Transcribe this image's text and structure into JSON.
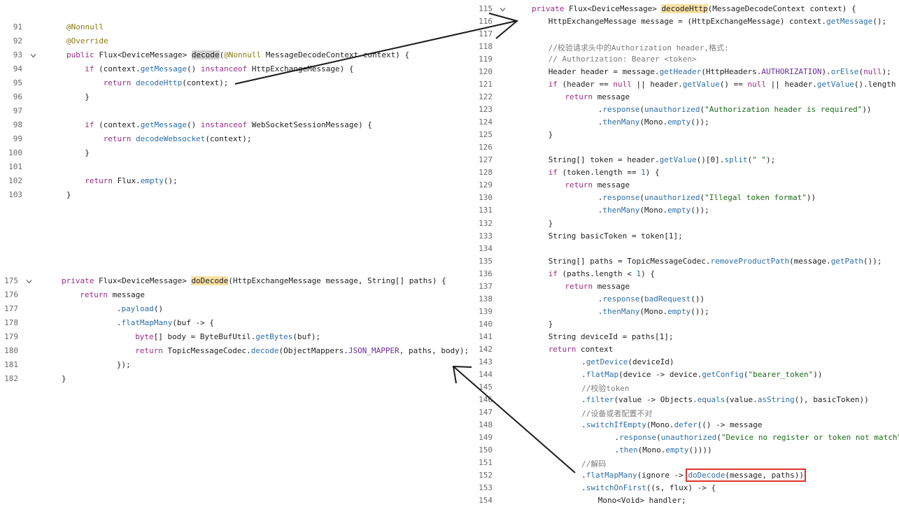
{
  "panel_decode": {
    "lines": [
      {
        "n": "91",
        "fold": false,
        "indent": 0,
        "tokens": [
          {
            "t": "@Nonnull",
            "c": "an"
          }
        ]
      },
      {
        "n": "92",
        "fold": false,
        "indent": 0,
        "tokens": [
          {
            "t": "@Override",
            "c": "an"
          }
        ]
      },
      {
        "n": "93",
        "fold": true,
        "indent": 0,
        "tokens": [
          {
            "t": "public ",
            "c": "kw"
          },
          {
            "t": "Flux<DeviceMessage> "
          },
          {
            "t": "decode",
            "c": "hl-grey"
          },
          {
            "t": "("
          },
          {
            "t": "@Nonnull",
            "c": "an"
          },
          {
            "t": " MessageDecodeContext context) {"
          }
        ]
      },
      {
        "n": "94",
        "fold": false,
        "indent": 1,
        "tokens": [
          {
            "t": "if",
            "c": "kw"
          },
          {
            "t": " (context."
          },
          {
            "t": "getMessage",
            "c": "mt"
          },
          {
            "t": "() "
          },
          {
            "t": "instanceof",
            "c": "kw"
          },
          {
            "t": " HttpExchangeMessage) {"
          }
        ]
      },
      {
        "n": "95",
        "fold": false,
        "indent": 2,
        "tokens": [
          {
            "t": "return",
            "c": "kw"
          },
          {
            "t": " "
          },
          {
            "t": "decodeHttp",
            "c": "mt"
          },
          {
            "t": "(context);"
          }
        ]
      },
      {
        "n": "96",
        "fold": false,
        "indent": 1,
        "tokens": [
          {
            "t": "}"
          }
        ]
      },
      {
        "n": "97",
        "fold": false,
        "indent": 0,
        "tokens": []
      },
      {
        "n": "98",
        "fold": false,
        "indent": 1,
        "tokens": [
          {
            "t": "if",
            "c": "kw"
          },
          {
            "t": " (context."
          },
          {
            "t": "getMessage",
            "c": "mt"
          },
          {
            "t": "() "
          },
          {
            "t": "instanceof",
            "c": "kw"
          },
          {
            "t": " WebSocketSessionMessage) {"
          }
        ]
      },
      {
        "n": "99",
        "fold": false,
        "indent": 2,
        "tokens": [
          {
            "t": "return",
            "c": "kw"
          },
          {
            "t": " "
          },
          {
            "t": "decodeWebsocket",
            "c": "mt"
          },
          {
            "t": "(context);"
          }
        ]
      },
      {
        "n": "100",
        "fold": false,
        "indent": 1,
        "tokens": [
          {
            "t": "}"
          }
        ]
      },
      {
        "n": "101",
        "fold": false,
        "indent": 0,
        "tokens": []
      },
      {
        "n": "102",
        "fold": false,
        "indent": 1,
        "tokens": [
          {
            "t": "return",
            "c": "kw"
          },
          {
            "t": " Flux."
          },
          {
            "t": "empty",
            "c": "mt"
          },
          {
            "t": "();"
          }
        ]
      },
      {
        "n": "103",
        "fold": false,
        "indent": 0,
        "tokens": [
          {
            "t": "}"
          }
        ]
      }
    ]
  },
  "panel_dodecode": {
    "lines": [
      {
        "n": "175",
        "fold": true,
        "indent": 0,
        "tokens": [
          {
            "t": "private ",
            "c": "kw"
          },
          {
            "t": "Flux<DeviceMessage> "
          },
          {
            "t": "doDecode",
            "c": "hl-yellow"
          },
          {
            "t": "(HttpExchangeMessage message, String[] paths) {"
          }
        ]
      },
      {
        "n": "176",
        "fold": false,
        "indent": 1,
        "tokens": [
          {
            "t": "return",
            "c": "kw"
          },
          {
            "t": " message"
          }
        ]
      },
      {
        "n": "177",
        "fold": false,
        "indent": 3,
        "tokens": [
          {
            "t": "."
          },
          {
            "t": "payload",
            "c": "mt"
          },
          {
            "t": "()"
          }
        ]
      },
      {
        "n": "178",
        "fold": false,
        "indent": 3,
        "tokens": [
          {
            "t": "."
          },
          {
            "t": "flatMapMany",
            "c": "mt"
          },
          {
            "t": "(buf -> {"
          }
        ]
      },
      {
        "n": "179",
        "fold": false,
        "indent": 4,
        "tokens": [
          {
            "t": "byte",
            "c": "kw"
          },
          {
            "t": "[] body = ByteBufUtil."
          },
          {
            "t": "getBytes",
            "c": "mt"
          },
          {
            "t": "(buf);"
          }
        ]
      },
      {
        "n": "180",
        "fold": false,
        "indent": 4,
        "tokens": [
          {
            "t": "return",
            "c": "kw"
          },
          {
            "t": " TopicMessageCodec."
          },
          {
            "t": "decode",
            "c": "mt"
          },
          {
            "t": "(ObjectMappers."
          },
          {
            "t": "JSON_MAPPER",
            "c": "cn"
          },
          {
            "t": ", paths, body);"
          }
        ]
      },
      {
        "n": "181",
        "fold": false,
        "indent": 3,
        "tokens": [
          {
            "t": "});"
          }
        ]
      },
      {
        "n": "182",
        "fold": false,
        "indent": 0,
        "tokens": [
          {
            "t": "}"
          }
        ]
      }
    ]
  },
  "panel_decodehttp": {
    "lines": [
      {
        "n": "115",
        "fold": true,
        "indent": 0,
        "tokens": [
          {
            "t": "private ",
            "c": "kw"
          },
          {
            "t": "Flux<DeviceMessage> "
          },
          {
            "t": "decodeHttp",
            "c": "hl-yellow"
          },
          {
            "t": "(MessageDecodeContext context) {"
          }
        ]
      },
      {
        "n": "116",
        "fold": false,
        "indent": 1,
        "tokens": [
          {
            "t": "HttpExchangeMessage message = (HttpExchangeMessage) context."
          },
          {
            "t": "getMessage",
            "c": "mt"
          },
          {
            "t": "();"
          }
        ]
      },
      {
        "n": "117",
        "fold": false,
        "indent": 0,
        "tokens": []
      },
      {
        "n": "118",
        "fold": false,
        "indent": 1,
        "tokens": [
          {
            "t": "//校验请求头中的Authorization header,格式:",
            "c": "cm"
          }
        ]
      },
      {
        "n": "119",
        "fold": false,
        "indent": 1,
        "tokens": [
          {
            "t": "// Authorization: Bearer <token>",
            "c": "cm"
          }
        ]
      },
      {
        "n": "120",
        "fold": false,
        "indent": 1,
        "tokens": [
          {
            "t": "Header header = message."
          },
          {
            "t": "getHeader",
            "c": "mt"
          },
          {
            "t": "(HttpHeaders."
          },
          {
            "t": "AUTHORIZATION",
            "c": "cn"
          },
          {
            "t": ")."
          },
          {
            "t": "orElse",
            "c": "mt"
          },
          {
            "t": "("
          },
          {
            "t": "null",
            "c": "kw"
          },
          {
            "t": ");"
          }
        ]
      },
      {
        "n": "121",
        "fold": false,
        "indent": 1,
        "tokens": [
          {
            "t": "if",
            "c": "kw"
          },
          {
            "t": " (header == "
          },
          {
            "t": "null",
            "c": "kw"
          },
          {
            "t": " || header."
          },
          {
            "t": "getValue",
            "c": "mt"
          },
          {
            "t": "() == "
          },
          {
            "t": "null",
            "c": "kw"
          },
          {
            "t": " || header."
          },
          {
            "t": "getValue",
            "c": "mt"
          },
          {
            "t": "().length == "
          },
          {
            "t": "0",
            "c": "mt"
          },
          {
            "t": ") {"
          }
        ]
      },
      {
        "n": "122",
        "fold": false,
        "indent": 2,
        "tokens": [
          {
            "t": "return",
            "c": "kw"
          },
          {
            "t": " message"
          }
        ]
      },
      {
        "n": "123",
        "fold": false,
        "indent": 4,
        "tokens": [
          {
            "t": "."
          },
          {
            "t": "response",
            "c": "mt"
          },
          {
            "t": "("
          },
          {
            "t": "unauthorized",
            "c": "mt"
          },
          {
            "t": "("
          },
          {
            "t": "\"Authorization header is required\"",
            "c": "st"
          },
          {
            "t": "))"
          }
        ]
      },
      {
        "n": "124",
        "fold": false,
        "indent": 4,
        "tokens": [
          {
            "t": "."
          },
          {
            "t": "thenMany",
            "c": "mt"
          },
          {
            "t": "(Mono."
          },
          {
            "t": "empty",
            "c": "mt"
          },
          {
            "t": "());"
          }
        ]
      },
      {
        "n": "125",
        "fold": false,
        "indent": 1,
        "tokens": [
          {
            "t": "}"
          }
        ]
      },
      {
        "n": "126",
        "fold": false,
        "indent": 0,
        "tokens": []
      },
      {
        "n": "127",
        "fold": false,
        "indent": 1,
        "tokens": [
          {
            "t": "String[] token = header."
          },
          {
            "t": "getValue",
            "c": "mt"
          },
          {
            "t": "()[0]."
          },
          {
            "t": "split",
            "c": "mt"
          },
          {
            "t": "("
          },
          {
            "t": "\" \"",
            "c": "st"
          },
          {
            "t": ");"
          }
        ]
      },
      {
        "n": "128",
        "fold": false,
        "indent": 1,
        "tokens": [
          {
            "t": "if",
            "c": "kw"
          },
          {
            "t": " (token.length == "
          },
          {
            "t": "1",
            "c": "mt"
          },
          {
            "t": ") {"
          }
        ]
      },
      {
        "n": "129",
        "fold": false,
        "indent": 2,
        "tokens": [
          {
            "t": "return",
            "c": "kw"
          },
          {
            "t": " message"
          }
        ]
      },
      {
        "n": "130",
        "fold": false,
        "indent": 4,
        "tokens": [
          {
            "t": "."
          },
          {
            "t": "response",
            "c": "mt"
          },
          {
            "t": "("
          },
          {
            "t": "unauthorized",
            "c": "mt"
          },
          {
            "t": "("
          },
          {
            "t": "\"Illegal token format\"",
            "c": "st"
          },
          {
            "t": "))"
          }
        ]
      },
      {
        "n": "131",
        "fold": false,
        "indent": 4,
        "tokens": [
          {
            "t": "."
          },
          {
            "t": "thenMany",
            "c": "mt"
          },
          {
            "t": "(Mono."
          },
          {
            "t": "empty",
            "c": "mt"
          },
          {
            "t": "());"
          }
        ]
      },
      {
        "n": "132",
        "fold": false,
        "indent": 1,
        "tokens": [
          {
            "t": "}"
          }
        ]
      },
      {
        "n": "133",
        "fold": false,
        "indent": 1,
        "tokens": [
          {
            "t": "String basicToken = token[1];"
          }
        ]
      },
      {
        "n": "134",
        "fold": false,
        "indent": 0,
        "tokens": []
      },
      {
        "n": "135",
        "fold": false,
        "indent": 1,
        "tokens": [
          {
            "t": "String[] paths = TopicMessageCodec."
          },
          {
            "t": "removeProductPath",
            "c": "mt"
          },
          {
            "t": "(message."
          },
          {
            "t": "getPath",
            "c": "mt"
          },
          {
            "t": "());"
          }
        ]
      },
      {
        "n": "136",
        "fold": false,
        "indent": 1,
        "tokens": [
          {
            "t": "if",
            "c": "kw"
          },
          {
            "t": " (paths.length < "
          },
          {
            "t": "1",
            "c": "mt"
          },
          {
            "t": ") {"
          }
        ]
      },
      {
        "n": "137",
        "fold": false,
        "indent": 2,
        "tokens": [
          {
            "t": "return",
            "c": "kw"
          },
          {
            "t": " message"
          }
        ]
      },
      {
        "n": "138",
        "fold": false,
        "indent": 4,
        "tokens": [
          {
            "t": "."
          },
          {
            "t": "response",
            "c": "mt"
          },
          {
            "t": "("
          },
          {
            "t": "badRequest",
            "c": "mt"
          },
          {
            "t": "())"
          }
        ]
      },
      {
        "n": "139",
        "fold": false,
        "indent": 4,
        "tokens": [
          {
            "t": "."
          },
          {
            "t": "thenMany",
            "c": "mt"
          },
          {
            "t": "(Mono."
          },
          {
            "t": "empty",
            "c": "mt"
          },
          {
            "t": "());"
          }
        ]
      },
      {
        "n": "140",
        "fold": false,
        "indent": 1,
        "tokens": [
          {
            "t": "}"
          }
        ]
      },
      {
        "n": "141",
        "fold": false,
        "indent": 1,
        "tokens": [
          {
            "t": "String deviceId = paths[1];"
          }
        ]
      },
      {
        "n": "142",
        "fold": false,
        "indent": 1,
        "tokens": [
          {
            "t": "return",
            "c": "kw"
          },
          {
            "t": " context"
          }
        ]
      },
      {
        "n": "143",
        "fold": false,
        "indent": 3,
        "tokens": [
          {
            "t": "."
          },
          {
            "t": "getDevice",
            "c": "mt"
          },
          {
            "t": "(deviceId)"
          }
        ]
      },
      {
        "n": "144",
        "fold": false,
        "indent": 3,
        "tokens": [
          {
            "t": "."
          },
          {
            "t": "flatMap",
            "c": "mt"
          },
          {
            "t": "(device -> device."
          },
          {
            "t": "getConfig",
            "c": "mt"
          },
          {
            "t": "("
          },
          {
            "t": "\"bearer_token\"",
            "c": "st"
          },
          {
            "t": "))"
          }
        ]
      },
      {
        "n": "145",
        "fold": false,
        "indent": 3,
        "tokens": [
          {
            "t": "//校验token",
            "c": "cm"
          }
        ]
      },
      {
        "n": "146",
        "fold": false,
        "indent": 3,
        "tokens": [
          {
            "t": "."
          },
          {
            "t": "filter",
            "c": "mt"
          },
          {
            "t": "(value -> Objects."
          },
          {
            "t": "equals",
            "c": "mt"
          },
          {
            "t": "(value."
          },
          {
            "t": "asString",
            "c": "mt"
          },
          {
            "t": "(), basicToken))"
          }
        ]
      },
      {
        "n": "147",
        "fold": false,
        "indent": 3,
        "tokens": [
          {
            "t": "//设备或者配置不对",
            "c": "cm"
          }
        ]
      },
      {
        "n": "148",
        "fold": false,
        "indent": 3,
        "tokens": [
          {
            "t": "."
          },
          {
            "t": "switchIfEmpty",
            "c": "mt"
          },
          {
            "t": "(Mono."
          },
          {
            "t": "defer",
            "c": "mt"
          },
          {
            "t": "(() -> message"
          }
        ]
      },
      {
        "n": "149",
        "fold": false,
        "indent": 5,
        "tokens": [
          {
            "t": "."
          },
          {
            "t": "response",
            "c": "mt"
          },
          {
            "t": "("
          },
          {
            "t": "unauthorized",
            "c": "mt"
          },
          {
            "t": "("
          },
          {
            "t": "\"Device no register or token not match\"",
            "c": "st"
          },
          {
            "t": "))"
          }
        ]
      },
      {
        "n": "150",
        "fold": false,
        "indent": 5,
        "tokens": [
          {
            "t": "."
          },
          {
            "t": "then",
            "c": "mt"
          },
          {
            "t": "(Mono."
          },
          {
            "t": "empty",
            "c": "mt"
          },
          {
            "t": "())))"
          }
        ]
      },
      {
        "n": "151",
        "fold": false,
        "indent": 3,
        "tokens": [
          {
            "t": "//解码",
            "c": "cm"
          }
        ]
      },
      {
        "n": "152",
        "fold": false,
        "indent": 3,
        "tokens": [
          {
            "t": "."
          },
          {
            "t": "flatMapMany",
            "c": "mt"
          },
          {
            "t": "(ignore -> "
          },
          {
            "t": "doDecode",
            "c": "mt",
            "box": true
          },
          {
            "t": "(message, paths))",
            "box": true
          }
        ]
      },
      {
        "n": "153",
        "fold": false,
        "indent": 3,
        "tokens": [
          {
            "t": "."
          },
          {
            "t": "switchOnFirst",
            "c": "mt"
          },
          {
            "t": "((s, flux) -> {"
          }
        ]
      },
      {
        "n": "154",
        "fold": false,
        "indent": 4,
        "tokens": [
          {
            "t": "Mono<Void> handler;"
          }
        ]
      }
    ]
  }
}
